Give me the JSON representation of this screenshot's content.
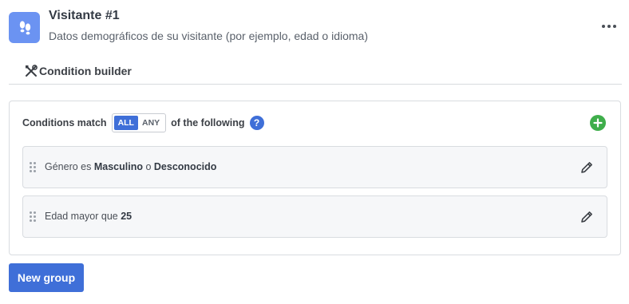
{
  "header": {
    "icon": "footprints-icon",
    "title": "Visitante #1",
    "subtitle": "Datos demográficos de su visitante (por ejemplo, edad o idioma)",
    "more_icon": "more-horizontal-icon"
  },
  "tabs": [
    {
      "icon": "tools-icon",
      "label": "Condition builder",
      "active": true
    }
  ],
  "group": {
    "match_prefix": "Conditions match",
    "match_options": [
      "ALL",
      "ANY"
    ],
    "match_selected": "ALL",
    "match_suffix": "of the following",
    "help_label": "?",
    "add_icon": "plus-circle-icon",
    "conditions": [
      {
        "prefix": "Género es",
        "value1": "Masculino",
        "joiner": "o",
        "value2": "Desconocido"
      },
      {
        "prefix": "Edad mayor que",
        "value1": "25"
      }
    ]
  },
  "new_group_label": "New group",
  "colors": {
    "accent": "#3f6fd8",
    "avatar": "#6b93f2",
    "add": "#3fae4b",
    "rule_bg": "#f6f7f9"
  }
}
